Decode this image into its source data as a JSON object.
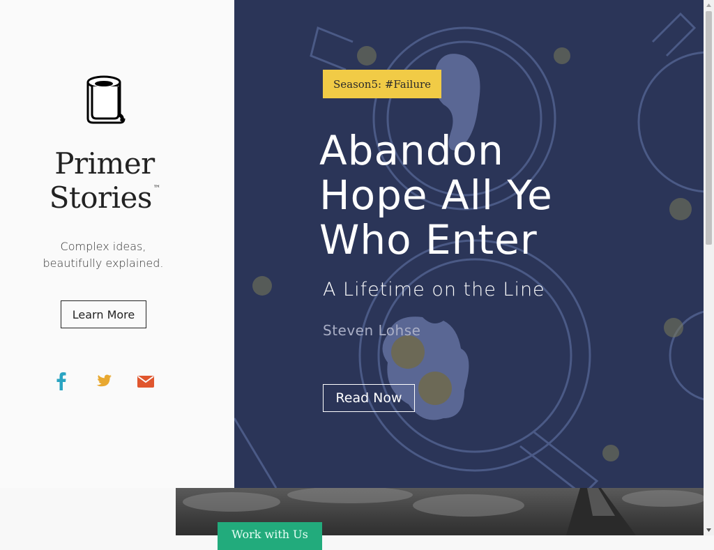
{
  "sidebar": {
    "brand_line1": "Primer",
    "brand_line2": "Stories",
    "brand_tm": "™",
    "tagline_line1": "Complex ideas,",
    "tagline_line2": "beautifully explained.",
    "learn_more": "Learn More",
    "social": [
      {
        "icon": "facebook-icon",
        "color": "#2aa4c2"
      },
      {
        "icon": "twitter-icon",
        "color": "#e8a830"
      },
      {
        "icon": "envelope-icon",
        "color": "#e0562e"
      }
    ]
  },
  "hero": {
    "season_badge": "Season5: #Failure",
    "title_line1": "Abandon",
    "title_line2": "Hope All Ye",
    "title_line3": "Who Enter",
    "subtitle": "A Lifetime on the Line",
    "author": "Steven Lohse",
    "read_now": "Read Now",
    "background_color": "#2b3558",
    "badge_color": "#f1cb46"
  },
  "footer_section": {
    "work_with_us": "Work with Us",
    "button_color": "#22ab7c"
  }
}
